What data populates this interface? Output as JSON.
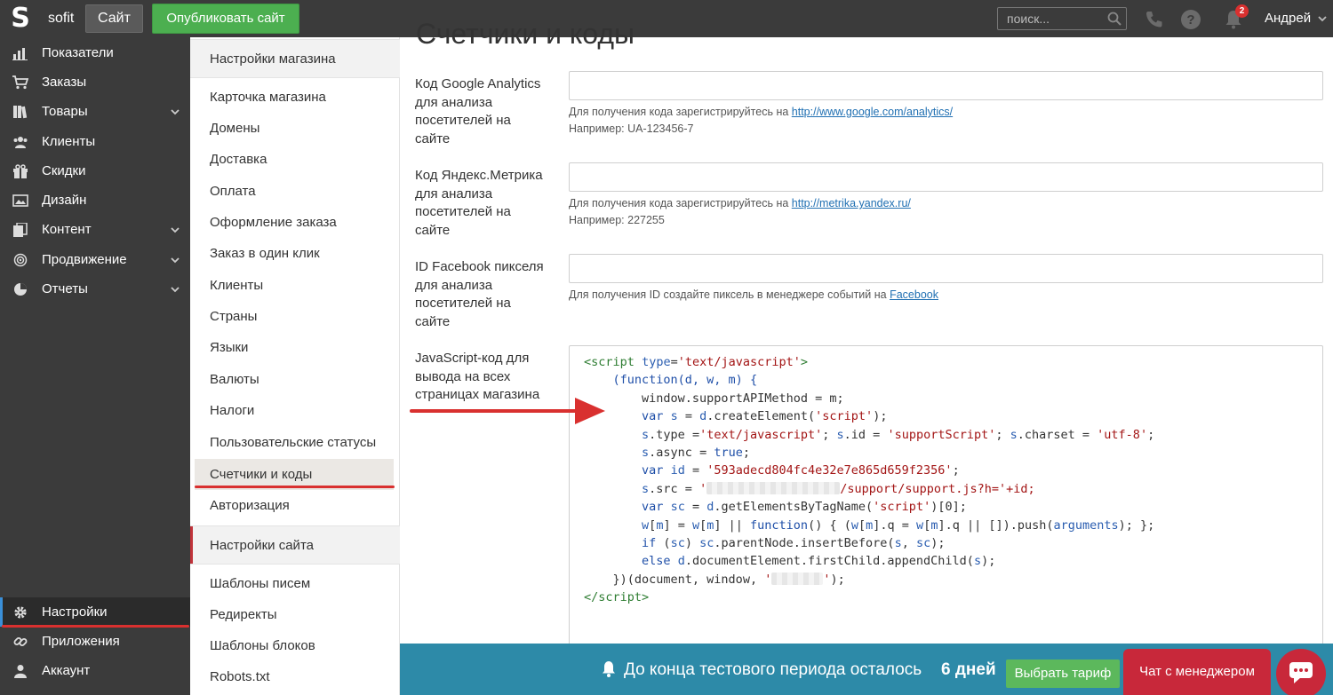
{
  "topbar": {
    "brand": "sofit",
    "site_button": "Сайт",
    "publish_button": "Опубликовать сайт",
    "search_placeholder": "поиск...",
    "notifications_count": "2",
    "user_name": "Андрей"
  },
  "sidebar": {
    "items": [
      {
        "label": "Показатели",
        "icon": "bar-chart-icon"
      },
      {
        "label": "Заказы",
        "icon": "cart-icon"
      },
      {
        "label": "Товары",
        "icon": "books-icon",
        "expandable": true
      },
      {
        "label": "Клиенты",
        "icon": "users-icon"
      },
      {
        "label": "Скидки",
        "icon": "gift-icon"
      },
      {
        "label": "Дизайн",
        "icon": "image-icon"
      },
      {
        "label": "Контент",
        "icon": "copy-icon",
        "expandable": true
      },
      {
        "label": "Продвижение",
        "icon": "target-icon",
        "expandable": true
      },
      {
        "label": "Отчеты",
        "icon": "pie-icon",
        "expandable": true
      }
    ],
    "bottom_items": [
      {
        "label": "Настройки",
        "icon": "gear-icon",
        "active": true
      },
      {
        "label": "Приложения",
        "icon": "link-icon"
      },
      {
        "label": "Аккаунт",
        "icon": "user-icon"
      }
    ]
  },
  "submenu": {
    "store_header": "Настройки магазина",
    "store_items": [
      "Карточка магазина",
      "Домены",
      "Доставка",
      "Оплата",
      "Оформление заказа",
      "Заказ в один клик",
      "Клиенты",
      "Страны",
      "Языки",
      "Валюты",
      "Налоги",
      "Пользовательские статусы",
      "Счетчики и коды",
      "Авторизация"
    ],
    "active_item": "Счетчики и коды",
    "site_header": "Настройки сайта",
    "site_items": [
      "Шаблоны писем",
      "Редиректы",
      "Шаблоны блоков",
      "Robots.txt"
    ]
  },
  "main": {
    "title": "Счетчики и коды",
    "fields": [
      {
        "label_lines": [
          "Код Google Analytics",
          "для анализа",
          "посетителей на",
          "сайте"
        ],
        "value": "",
        "hint_prefix": "Для получения кода зарегистрируйтесь на ",
        "hint_link": "http://www.google.com/analytics/",
        "example": "Например: UA-123456-7"
      },
      {
        "label_lines": [
          "Код Яндекс.Метрика",
          "для анализа",
          "посетителей на",
          "сайте"
        ],
        "value": "",
        "hint_prefix": "Для получения кода зарегистрируйтесь на ",
        "hint_link": "http://metrika.yandex.ru/",
        "example": "Например: 227255"
      },
      {
        "label_lines": [
          "ID Facebook пикселя",
          "для анализа",
          "посетителей на",
          "сайте"
        ],
        "value": "",
        "hint_prefix": "Для получения ID создайте пиксель в менеджере событий на ",
        "hint_link": "Facebook"
      }
    ],
    "js_label_lines": [
      "JavaScript-код для",
      "вывода на всех",
      "страницах магазина"
    ],
    "code": {
      "script_open_tag": "script",
      "type_attr": "type",
      "type_value": "'text/javascript'",
      "fn_decl": "(function(d, w, m) {",
      "line_api": "window.supportAPIMethod = m;",
      "id_value": "'593adecd804fc4e32e7e865d659f2356'",
      "src_tail": "/support/support.js?h='+id;",
      "close_call": "})(document, window, ",
      "script_close_tag": "script"
    }
  },
  "trial": {
    "text": "До конца тестового периода осталось",
    "days": "6 дней",
    "button": "Выбрать тариф"
  },
  "chat": {
    "button": "Чат с менеджером"
  },
  "colors": {
    "topbar_bg": "#3b3b3b",
    "publish_green": "#4caf50",
    "trial_bg": "#2d8aa8",
    "chat_red": "#c8283a",
    "annotation_red": "#d9302f"
  }
}
